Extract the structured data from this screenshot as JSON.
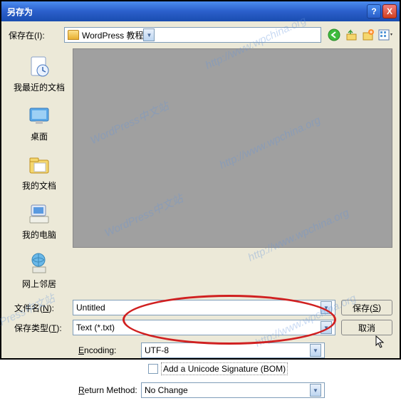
{
  "titlebar": {
    "title": "另存为",
    "help": "?",
    "close": "X"
  },
  "savein": {
    "label": "保存在(I):",
    "folder": "WordPress 教程"
  },
  "sidebar": {
    "items": [
      {
        "label": "我最近的文档"
      },
      {
        "label": "桌面"
      },
      {
        "label": "我的文档"
      },
      {
        "label": "我的电脑"
      },
      {
        "label": "网上邻居"
      }
    ]
  },
  "fields": {
    "filename_label": "文件名(N):",
    "filename_value": "Untitled",
    "filetype_label": "保存类型(T):",
    "filetype_value": "Text (*.txt)",
    "encoding_label": "Encoding:",
    "encoding_value": "UTF-8",
    "bom_label": "Add a Unicode Signature (BOM)",
    "return_label": "Return Method:",
    "return_value": "No Change"
  },
  "buttons": {
    "save": "保存(S)",
    "cancel": "取消"
  },
  "watermarks": [
    "http://www.wpchina.org",
    "WordPress中文站",
    "http://www.wpchina.org",
    "WordPress中文站",
    "http://www.wpchina.org",
    "WordPress中文站",
    "http://www.wpchina.org"
  ]
}
